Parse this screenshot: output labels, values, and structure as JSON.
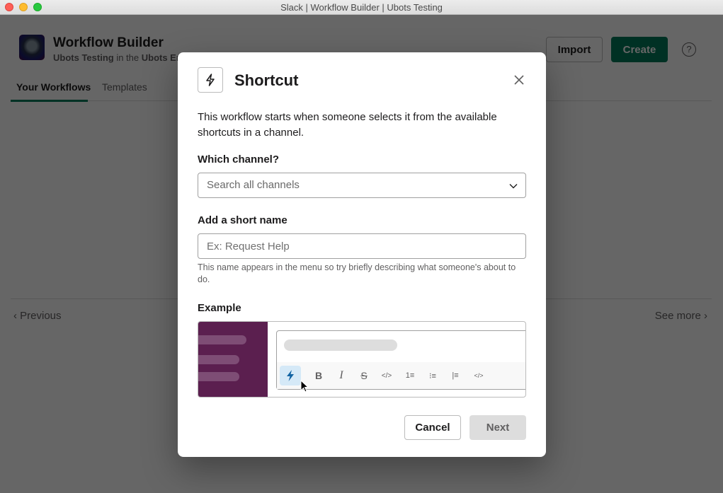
{
  "window": {
    "title": "Slack | Workflow Builder | Ubots Testing"
  },
  "header": {
    "title": "Workflow Builder",
    "subtitle_workspace": "Ubots Testing",
    "subtitle_connector": " in the ",
    "subtitle_org": "Ubots Ent",
    "import_label": "Import",
    "create_label": "Create",
    "help_icon": "?"
  },
  "tabs": [
    {
      "label": "Your Workflows",
      "active": true
    },
    {
      "label": "Templates",
      "active": false
    }
  ],
  "pager": {
    "previous_label": "‹ Previous",
    "see_more_label": "See more ›"
  },
  "modal": {
    "icon": "lightning-bolt-icon",
    "title": "Shortcut",
    "description": "This workflow starts when someone selects it from the available shortcuts in a channel.",
    "channel_label": "Which channel?",
    "channel_placeholder": "Search all channels",
    "short_name_label": "Add a short name",
    "short_name_placeholder": "Ex: Request Help",
    "short_name_value": "",
    "short_name_hint": "This name appears in the menu so try briefly describing what someone's about to do.",
    "example_label": "Example",
    "example_toolbar": [
      {
        "name": "shortcuts-icon",
        "glyph": "⚡",
        "active": true
      },
      {
        "name": "bold-icon",
        "glyph": "B"
      },
      {
        "name": "italic-icon",
        "glyph": "I"
      },
      {
        "name": "strikethrough-icon",
        "glyph": "S"
      },
      {
        "name": "code-icon",
        "glyph": "</>"
      },
      {
        "name": "ordered-list-icon",
        "glyph": "1≡"
      },
      {
        "name": "bulleted-list-icon",
        "glyph": "⁝≡"
      },
      {
        "name": "blockquote-icon",
        "glyph": "|≡"
      },
      {
        "name": "code-block-icon",
        "glyph": "</>"
      }
    ],
    "cancel_label": "Cancel",
    "next_label": "Next"
  },
  "colors": {
    "brand_green": "#007a5a",
    "aubergine": "#5b1f4f",
    "shortcut_blue": "#1264a3"
  }
}
